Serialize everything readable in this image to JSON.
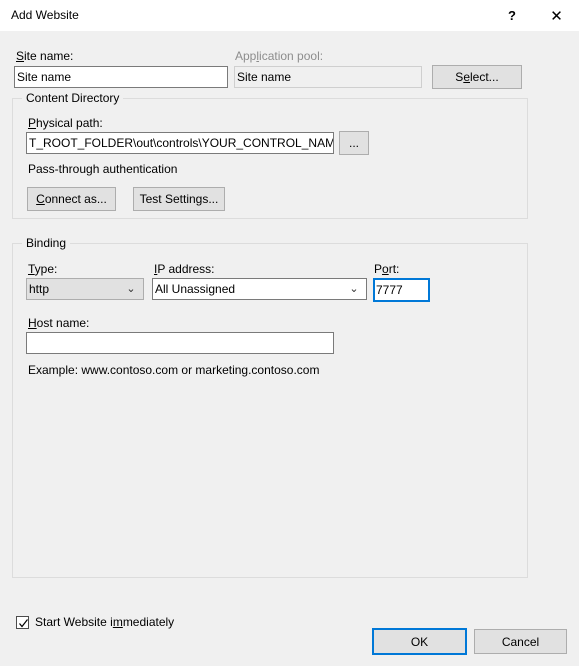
{
  "window": {
    "title": "Add Website",
    "help_glyph": "?",
    "close_glyph": "✕"
  },
  "site": {
    "name_label_pre": "S",
    "name_label_post": "ite name:",
    "name_value": "Site name",
    "app_pool_label_pre": "App",
    "app_pool_label_acc": "l",
    "app_pool_label_post": "ication pool:",
    "app_pool_value": "Site name",
    "select_button_pre": "S",
    "select_button_acc": "e",
    "select_button_post": "lect..."
  },
  "content_directory": {
    "group_title": "Content Directory",
    "physical_path_label_pre": "P",
    "physical_path_label_post": "hysical path:",
    "physical_path_value": "T_ROOT_FOLDER\\out\\controls\\YOUR_CONTROL_NAME\\",
    "browse_button_label": "...",
    "passthrough_text": "Pass-through authentication",
    "connect_as_pre": "C",
    "connect_as_post": "onnect as...",
    "test_settings_pre": "Test Settin",
    "test_settings_acc": "g",
    "test_settings_post": "s..."
  },
  "binding": {
    "group_title": "Binding",
    "type_label_pre": "T",
    "type_label_post": "ype:",
    "type_value": "http",
    "ip_label_pre": "I",
    "ip_label_post": "P address:",
    "ip_value": "All Unassigned",
    "port_label_pre": "P",
    "port_label_acc": "o",
    "port_label_post": "rt:",
    "port_value": "7777",
    "host_label_pre": "H",
    "host_label_post": "ost name:",
    "host_value": "",
    "example_text": "Example: www.contoso.com or marketing.contoso.com",
    "chevron_glyph": "⌄"
  },
  "footer": {
    "start_website_pre": "Start Website i",
    "start_website_acc": "m",
    "start_website_post": "mediately",
    "start_website_checked": true,
    "ok_label": "OK",
    "cancel_label": "Cancel"
  },
  "colors": {
    "accent": "#0078d7",
    "dialog_bg": "#f0f0f0",
    "titlebar_bg": "#ffffff",
    "button_face": "#e1e1e1",
    "disabled_text": "#8d8d8d"
  }
}
